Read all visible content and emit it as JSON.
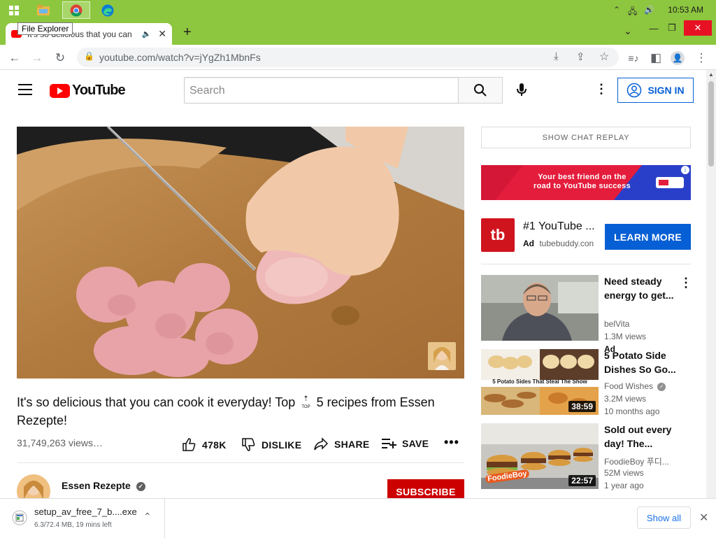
{
  "taskbar": {
    "clock": "10:53 AM",
    "icons": [
      "windows-start-icon",
      "file-explorer-icon",
      "chrome-icon",
      "edge-icon"
    ]
  },
  "tab": {
    "title": "It's so delicious that you can",
    "tooltip": "File Explorer"
  },
  "toolbar": {
    "url": "youtube.com/watch?v=jYgZh1MbnFs"
  },
  "youtube": {
    "logo_text": "YouTube",
    "search_placeholder": "Search",
    "signin_label": "SIGN IN"
  },
  "video": {
    "title_part1": "It's so delicious that you can cook it everyday! Top",
    "title_part2": "5 recipes from Essen Rezepte!",
    "views": "31,749,263 views…",
    "likes": "478K",
    "dislike_label": "DISLIKE",
    "share_label": "SHARE",
    "save_label": "SAVE",
    "channel_name": "Essen Rezepte",
    "subscribe_label": "SUBSCRIBE"
  },
  "sidebar": {
    "chat_replay": "SHOW CHAT REPLAY",
    "banner_text_line1": "Your best friend on the",
    "banner_text_line2": "road to YouTube success",
    "ad": {
      "logo": "tb",
      "title": "#1 YouTube ...",
      "ad_label": "Ad",
      "domain": "tubebuddy.con",
      "cta": "LEARN MORE"
    },
    "recommendations": [
      {
        "title": "Need steady energy to get...",
        "channel": "belVita",
        "views": "1.3M views",
        "extra": "Ad",
        "duration": ""
      },
      {
        "title": "5 Potato Side Dishes So Go...",
        "channel": "Food Wishes",
        "views": "3.2M views",
        "extra": "10 months ago",
        "duration": "38:59",
        "thumb_caption": "5 Potato Sides That Steal The Show"
      },
      {
        "title": "Sold out every day! The...",
        "channel": "FoodieBoy 푸디...",
        "views": "52M views",
        "extra": "1 year ago",
        "duration": "22:57",
        "thumb_caption": "FoodieBoy"
      }
    ]
  },
  "downloads": {
    "filename": "setup_av_free_7_b....exe",
    "status": "6.3/72.4 MB, 19 mins left",
    "show_all": "Show all"
  }
}
